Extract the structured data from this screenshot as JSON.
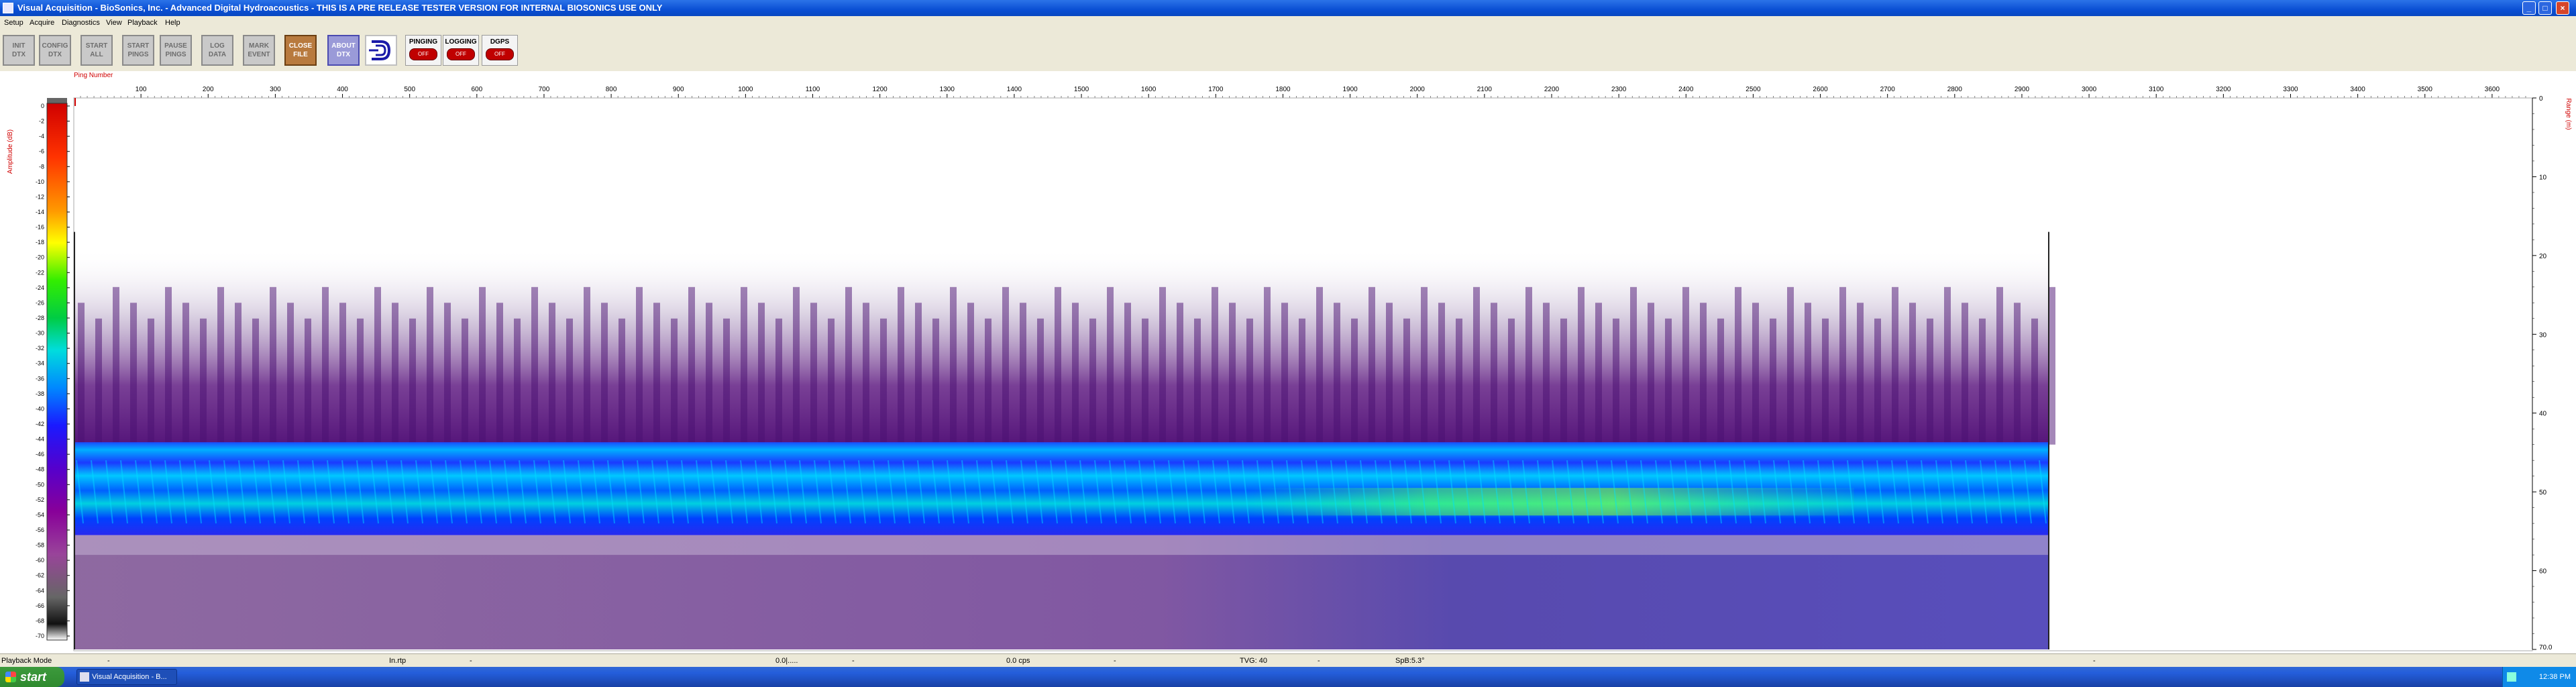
{
  "window": {
    "title": "Visual Acquisition  -  BioSonics, Inc.  -  Advanced Digital Hydroacoustics  -  THIS IS A PRE RELEASE TESTER VERSION FOR INTERNAL BIOSONICS USE ONLY",
    "minimize": "_",
    "maximize": "□",
    "close": "×"
  },
  "menu": [
    "Setup",
    "Acquire",
    "Diagnostics",
    "View",
    "Playback",
    "Help"
  ],
  "toolbar": {
    "buttons": [
      {
        "label1": "INIT",
        "label2": "DTX"
      },
      {
        "label1": "CONFIG",
        "label2": "DTX"
      },
      {
        "label1": "START",
        "label2": "ALL"
      },
      {
        "label1": "START",
        "label2": "PINGS"
      },
      {
        "label1": "PAUSE",
        "label2": "PINGS"
      },
      {
        "label1": "LOG",
        "label2": "DATA"
      },
      {
        "label1": "MARK",
        "label2": "EVENT"
      },
      {
        "label1": "CLOSE",
        "label2": "FILE"
      },
      {
        "label1": "ABOUT",
        "label2": "DTX"
      }
    ],
    "status": [
      {
        "label": "PINGING",
        "state": "OFF"
      },
      {
        "label": "LOGGING",
        "state": "OFF"
      },
      {
        "label": "DGPS",
        "state": "OFF"
      }
    ]
  },
  "echogram": {
    "x_axis_label": "Ping Number",
    "x_ticks": [
      100,
      200,
      300,
      400,
      500,
      600,
      700,
      800,
      900,
      1000,
      1100,
      1200,
      1300,
      1400,
      1500,
      1600,
      1700,
      1800,
      1900,
      2000,
      2100,
      2200,
      2300,
      2400,
      2500,
      2600,
      2700,
      2800,
      2900,
      3000,
      3100,
      3200,
      3300,
      3400,
      3500,
      3600
    ],
    "x_range": [
      0,
      3660
    ],
    "data_end_ping": 2940,
    "amplitude_label": "Amplitude (dB)",
    "amplitude_ticks": [
      0,
      -2,
      -4,
      -6,
      -8,
      -10,
      -12,
      -14,
      -16,
      -18,
      -20,
      -22,
      -24,
      -26,
      -28,
      -30,
      -32,
      -34,
      -36,
      -38,
      -40,
      -42,
      -44,
      -46,
      -48,
      -50,
      -52,
      -54,
      -56,
      -58,
      -60,
      -62,
      -64,
      -66,
      -68,
      -70
    ],
    "range_label": "Range (m)",
    "range_ticks": [
      0,
      10,
      20,
      30,
      40,
      50,
      60,
      70.0
    ],
    "range_tick_labels": [
      "0",
      "10",
      "20",
      "30",
      "40",
      "50",
      "60",
      "70.0"
    ],
    "range_max": 70
  },
  "statusbar": {
    "mode": "Playback Mode",
    "dash1": "-",
    "field2": "In.rtp",
    "dash2": "-",
    "field3": "0.0|.....",
    "dash3": "-",
    "field4": "0.0 cps",
    "dash4": "-",
    "field5": "TVG: 40",
    "dash5": "-",
    "field6": "SpB:5.3°",
    "dash6": "-"
  },
  "taskbar": {
    "start": "start",
    "task": "Visual Acquisition  -  B...",
    "clock": "12:38 PM"
  }
}
